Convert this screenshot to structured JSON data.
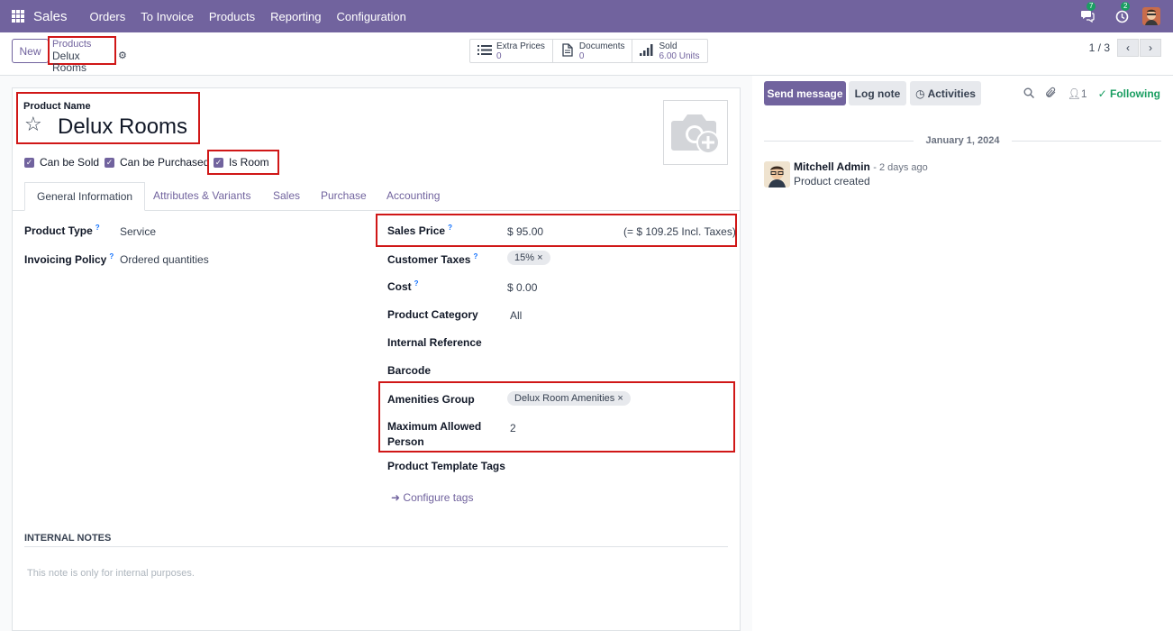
{
  "navbar": {
    "app_name": "Sales",
    "menu": [
      "Orders",
      "To Invoice",
      "Products",
      "Reporting",
      "Configuration"
    ],
    "chat_count": "7",
    "activity_count": "2",
    "bg_color": "#71639e"
  },
  "control": {
    "new_label": "New",
    "breadcrumb_parent": "Products",
    "breadcrumb_current": "Delux Rooms",
    "smart_buttons": [
      {
        "label": "Extra Prices",
        "value": "0",
        "icon": "list-icon"
      },
      {
        "label": "Documents",
        "value": "0",
        "icon": "document-icon"
      },
      {
        "label": "Sold",
        "value": "6.00 Units",
        "icon": "bar-chart-icon"
      }
    ],
    "pager": "1 / 3"
  },
  "form": {
    "product_name_label": "Product Name",
    "product_name": "Delux Rooms",
    "checkboxes": [
      {
        "label": "Can be Sold",
        "checked": true
      },
      {
        "label": "Can be Purchased",
        "checked": true
      },
      {
        "label": "Is Room",
        "checked": true
      }
    ],
    "tabs": [
      "General Information",
      "Attributes & Variants",
      "Sales",
      "Purchase",
      "Accounting"
    ],
    "left_fields": [
      {
        "label": "Product Type",
        "value": "Service"
      },
      {
        "label": "Invoicing Policy",
        "value": "Ordered quantities"
      }
    ],
    "sales_price_label": "Sales Price",
    "sales_price": "$ 95.00",
    "sales_price_incl": "(= $ 109.25 Incl. Taxes)",
    "customer_taxes_label": "Customer Taxes",
    "customer_tax_tag": "15%",
    "cost_label": "Cost",
    "cost": "$ 0.00",
    "category_label": "Product Category",
    "category": "All",
    "internal_ref_label": "Internal Reference",
    "barcode_label": "Barcode",
    "amenities_label": "Amenities Group",
    "amenities_tag": "Delux Room Amenities",
    "max_person_label_1": "Maximum Allowed",
    "max_person_label_2": "Person",
    "max_person": "2",
    "template_tags_label": "Product Template Tags",
    "configure_tags": "Configure tags",
    "notes_heading": "INTERNAL NOTES",
    "notes_placeholder": "This note is only for internal purposes."
  },
  "chatter": {
    "send_message": "Send message",
    "log_note": "Log note",
    "activities": "Activities",
    "followers_count": "1",
    "following": "Following",
    "date": "January 1, 2024",
    "author": "Mitchell Admin",
    "time": "- 2 days ago",
    "body": "Product created"
  }
}
